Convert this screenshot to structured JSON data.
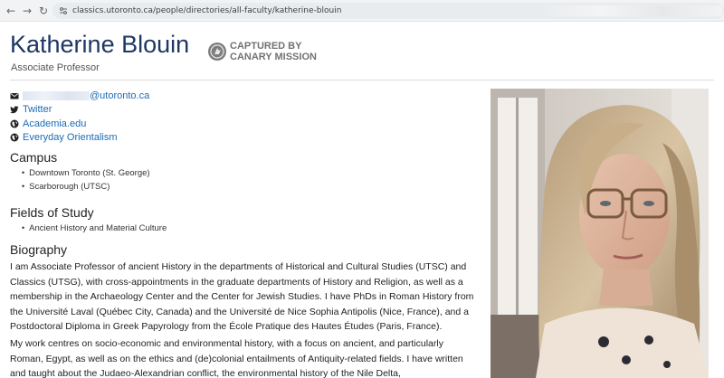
{
  "browser": {
    "url": "classics.utoronto.ca/people/directories/all-faculty/katherine-blouin",
    "back_icon": "arrow-left-icon",
    "forward_icon": "arrow-right-icon",
    "reload_icon": "reload-icon"
  },
  "profile": {
    "name": "Katherine Blouin",
    "title": "Associate Professor"
  },
  "stamp": {
    "line1": "CAPTURED BY",
    "line2": "CANARY MISSION"
  },
  "contact": {
    "email_domain": "@utoronto.ca",
    "links": [
      {
        "label": "Twitter",
        "icon": "twitter-icon"
      },
      {
        "label": "Academia.edu",
        "icon": "globe-icon"
      },
      {
        "label": "Everyday Orientalism",
        "icon": "globe-icon"
      }
    ]
  },
  "campus": {
    "heading": "Campus",
    "items": [
      "Downtown Toronto (St. George)",
      "Scarborough (UTSC)"
    ]
  },
  "fields": {
    "heading": "Fields of Study",
    "items": [
      "Ancient History and Material Culture"
    ]
  },
  "biography": {
    "heading": "Biography",
    "p1_lines": [
      "I am Associate Professor of ancient History in the departments of Historical and Cultural Studies (UTSC) and",
      "Classics (UTSG), with cross-appointments in the graduate departments of History and Religion, as well as a",
      "membership in the Archaeology Center and the Center for Jewish Studies. I have PhDs in Roman History from",
      "the Université Laval (Québec City, Canada) and the Université de Nice Sophia Antipolis (Nice, France), and a",
      "Postdoctoral Diploma in Greek Papyrology from the École Pratique des Hautes Études (Paris, France)."
    ],
    "p2_lines": [
      "My work centres on socio-economic and environmental history, with a focus on ancient, and particularly",
      "Roman, Egypt, as well as on the ethics and (de)colonial entailments of Antiquity-related fields. I have written",
      "and taught about the Judaeo-Alexandrian conflict, the environmental history of the Nile Delta,"
    ]
  },
  "colors": {
    "name": "#1e3765",
    "link": "#1c6bb5"
  }
}
